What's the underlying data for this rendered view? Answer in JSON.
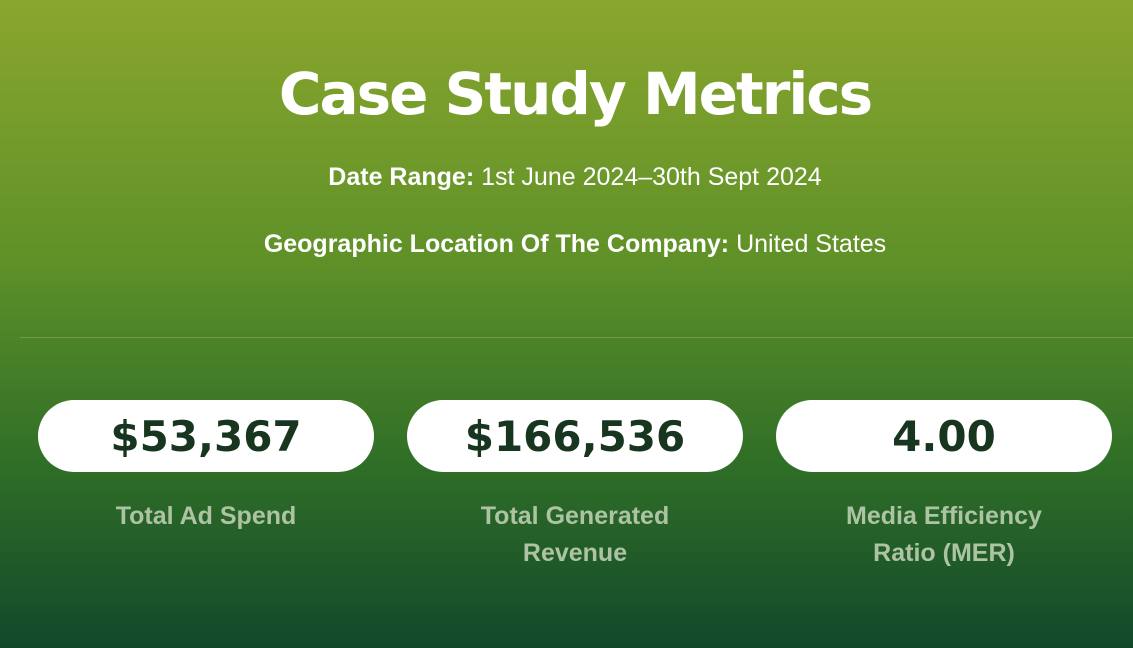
{
  "title": "Case Study Metrics",
  "date_range": {
    "label": "Date Range:",
    "value": "1st June 2024–30th Sept 2024"
  },
  "location": {
    "label": "Geographic Location Of The Company:",
    "value": "United States"
  },
  "metrics": [
    {
      "value": "$53,367",
      "label": "Total Ad Spend"
    },
    {
      "value": "$166,536",
      "label": "Total Generated Revenue"
    },
    {
      "value": "4.00",
      "label": "Media Efficiency Ratio (MER)"
    }
  ],
  "colors": {
    "gradient_top": "#8aa62e",
    "gradient_bottom": "#12482a",
    "pill_bg": "#ffffff",
    "pill_text": "#17351f",
    "label_text": "#aec3a3"
  }
}
